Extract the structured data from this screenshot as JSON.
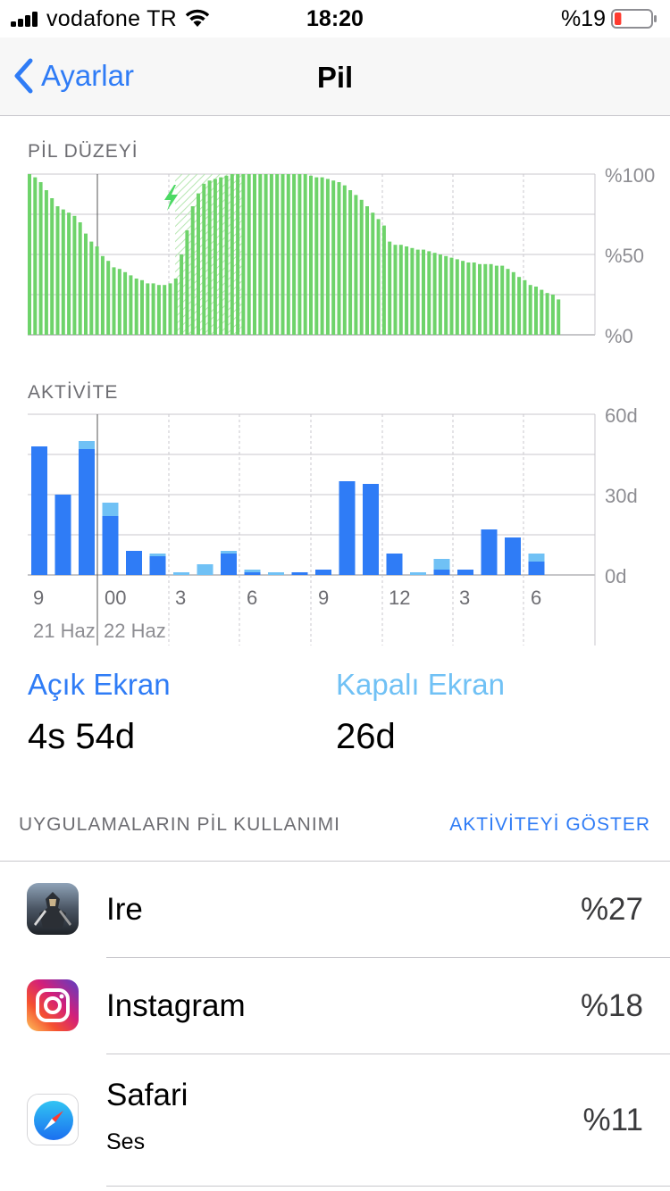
{
  "status_bar": {
    "carrier": "vodafone TR",
    "time": "18:20",
    "battery_percent": "%19",
    "battery_level": 0.19,
    "battery_color": "#ff3b30"
  },
  "nav": {
    "back_label": "Ayarlar",
    "title": "Pil"
  },
  "battery_section": {
    "title": "PİL DÜZEYİ",
    "y_ticks": [
      "%100",
      "%50",
      "%0"
    ]
  },
  "activity_section": {
    "title": "AKTİVİTE",
    "y_ticks": [
      "60d",
      "30d",
      "0d"
    ],
    "x_ticks": [
      "9",
      "00",
      "3",
      "6",
      "9",
      "12",
      "3",
      "6"
    ],
    "dates": [
      "21 Haz",
      "22 Haz"
    ]
  },
  "legend": {
    "screen_on_label": "Açık Ekran",
    "screen_on_value": "4s 54d",
    "screen_off_label": "Kapalı Ekran",
    "screen_off_value": "26d",
    "screen_on_color": "#2f7cf6",
    "screen_off_color": "#70c1f5"
  },
  "usage": {
    "header": "UYGULAMALARIN PİL KULLANIMI",
    "action": "AKTİVİTEYİ GÖSTER",
    "apps": [
      {
        "name": "Ire",
        "percent": "%27",
        "icon": "game-icon"
      },
      {
        "name": "Instagram",
        "percent": "%18",
        "icon": "instagram-icon"
      },
      {
        "name": "Safari",
        "subtitle": "Ses",
        "percent": "%11",
        "icon": "safari-compass-icon"
      }
    ]
  },
  "chart_data": [
    {
      "type": "bar",
      "title": "PİL DÜZEYİ",
      "ylabel": "",
      "ylim": [
        0,
        100
      ],
      "y_ticks": [
        "%0",
        "%50",
        "%100"
      ],
      "color": "#6ed36a",
      "charging_segment": {
        "from_index": 26,
        "to_index": 38
      },
      "values": [
        100,
        98,
        95,
        90,
        85,
        80,
        78,
        76,
        74,
        70,
        63,
        58,
        55,
        49,
        46,
        42,
        41,
        39,
        37,
        35,
        34,
        32,
        32,
        31,
        31,
        32,
        35,
        50,
        65,
        80,
        88,
        94,
        96,
        97,
        98,
        99,
        100,
        100,
        100,
        100,
        100,
        100,
        100,
        100,
        100,
        100,
        100,
        100,
        100,
        100,
        99,
        98,
        98,
        97,
        96,
        95,
        93,
        90,
        87,
        84,
        80,
        76,
        72,
        68,
        58,
        56,
        56,
        55,
        54,
        53,
        53,
        52,
        51,
        50,
        49,
        48,
        47,
        46,
        45,
        45,
        44,
        44,
        44,
        43,
        43,
        41,
        39,
        36,
        34,
        31,
        30,
        28,
        26,
        25,
        22
      ]
    },
    {
      "type": "bar",
      "title": "AKTİVİTE",
      "ylim": [
        0,
        60
      ],
      "y_ticks": [
        "0d",
        "30d",
        "60d"
      ],
      "x_ticks": [
        "9",
        "00",
        "3",
        "6",
        "9",
        "12",
        "3",
        "6"
      ],
      "series": [
        {
          "name": "Açık Ekran",
          "values": [
            48,
            30,
            47,
            22,
            9,
            7,
            0,
            0,
            8,
            1,
            0,
            1,
            2,
            35,
            34,
            8,
            0,
            2,
            2,
            17,
            14,
            5
          ]
        },
        {
          "name": "Kapalı Ekran",
          "values": [
            0,
            0,
            3,
            5,
            0,
            1,
            1,
            4,
            1,
            1,
            1,
            0,
            0,
            0,
            0,
            0,
            1,
            4,
            0,
            0,
            0,
            3
          ]
        }
      ]
    }
  ]
}
